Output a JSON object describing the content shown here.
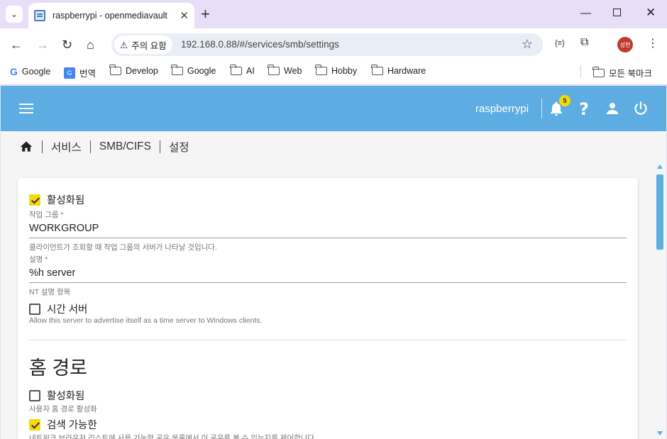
{
  "browser": {
    "tab_title": "raspberrypi - openmediavault",
    "security_chip": "주의 요함",
    "url": "192.168.0.88/#/services/smb/settings",
    "profile_initials": "성현",
    "bookmarks": [
      {
        "label": "Google",
        "icon": "google-icon"
      },
      {
        "label": "번역",
        "icon": "translate-icon"
      },
      {
        "label": "Develop",
        "icon": "folder-icon"
      },
      {
        "label": "Google",
        "icon": "folder-icon"
      },
      {
        "label": "AI",
        "icon": "folder-icon"
      },
      {
        "label": "Web",
        "icon": "folder-icon"
      },
      {
        "label": "Hobby",
        "icon": "folder-icon"
      },
      {
        "label": "Hardware",
        "icon": "folder-icon"
      }
    ],
    "all_bookmarks": "모든 북마크"
  },
  "header": {
    "hostname": "raspberrypi",
    "notification_count": "5",
    "color": "#5dade2"
  },
  "breadcrumb": [
    "서비스",
    "SMB/CIFS",
    "설정"
  ],
  "form": {
    "enabled_label": "활성화됨",
    "workgroup": {
      "label": "작업 그룹 *",
      "value": "WORKGROUP",
      "hint": "클라이언트가 조회할 때 작업 그룹의 서버가 나타날 것입니다."
    },
    "description": {
      "label": "설명 *",
      "value": "%h server",
      "hint": "NT 설명 항목"
    },
    "time_server": {
      "label": "시간 서버",
      "hint": "Allow this server to advertise itself as a time server to Windows clients."
    },
    "home_section": {
      "title": "홈 경로",
      "enabled_label": "활성화됨",
      "enabled_hint": "사용자 홈 경로 활성화",
      "browseable_label": "검색 가능한",
      "browseable_hint": "네트워크 브라우저 리스트에 사용 가능한 공유 목록에서 이 공유를 볼 수 있는지를 제어합니다."
    }
  },
  "accent_color": "#f5d90a"
}
